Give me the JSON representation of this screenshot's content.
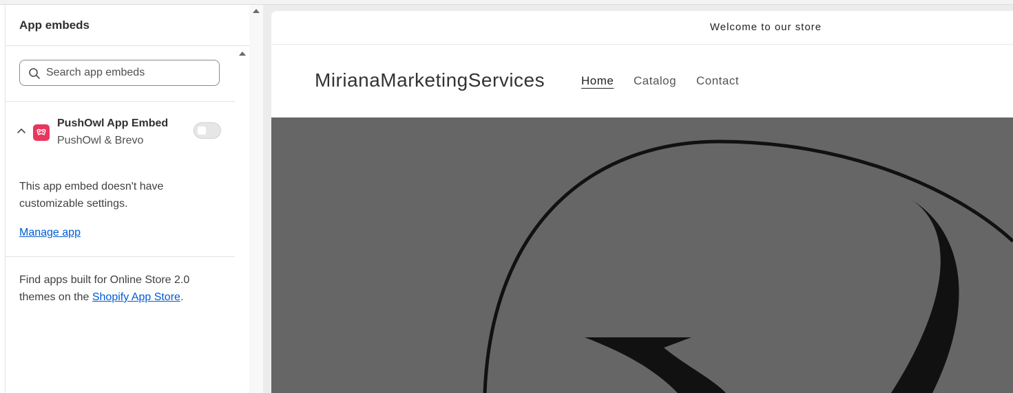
{
  "sidebar": {
    "title": "App embeds",
    "search": {
      "placeholder": "Search app embeds",
      "value": ""
    },
    "embed": {
      "title": "PushOwl App Embed",
      "subtitle": "PushOwl & Brevo",
      "enabled": false,
      "expanded": true,
      "icon": "pushowl-logo-icon",
      "icon_color": "#e8365d"
    },
    "description": "This app embed doesn't have customizable settings.",
    "manage_link": "Manage app",
    "find_prefix": "Find apps built for Online Store 2.0 themes on the ",
    "find_link": "Shopify App Store",
    "find_suffix": "."
  },
  "preview": {
    "announcement": "Welcome to our store",
    "brand": "MirianaMarketingServices",
    "nav": [
      {
        "label": "Home",
        "active": true
      },
      {
        "label": "Catalog",
        "active": false
      },
      {
        "label": "Contact",
        "active": false
      }
    ],
    "hero_color": "#666666"
  },
  "colors": {
    "link": "#005bd3",
    "accent": "#e8365d"
  }
}
